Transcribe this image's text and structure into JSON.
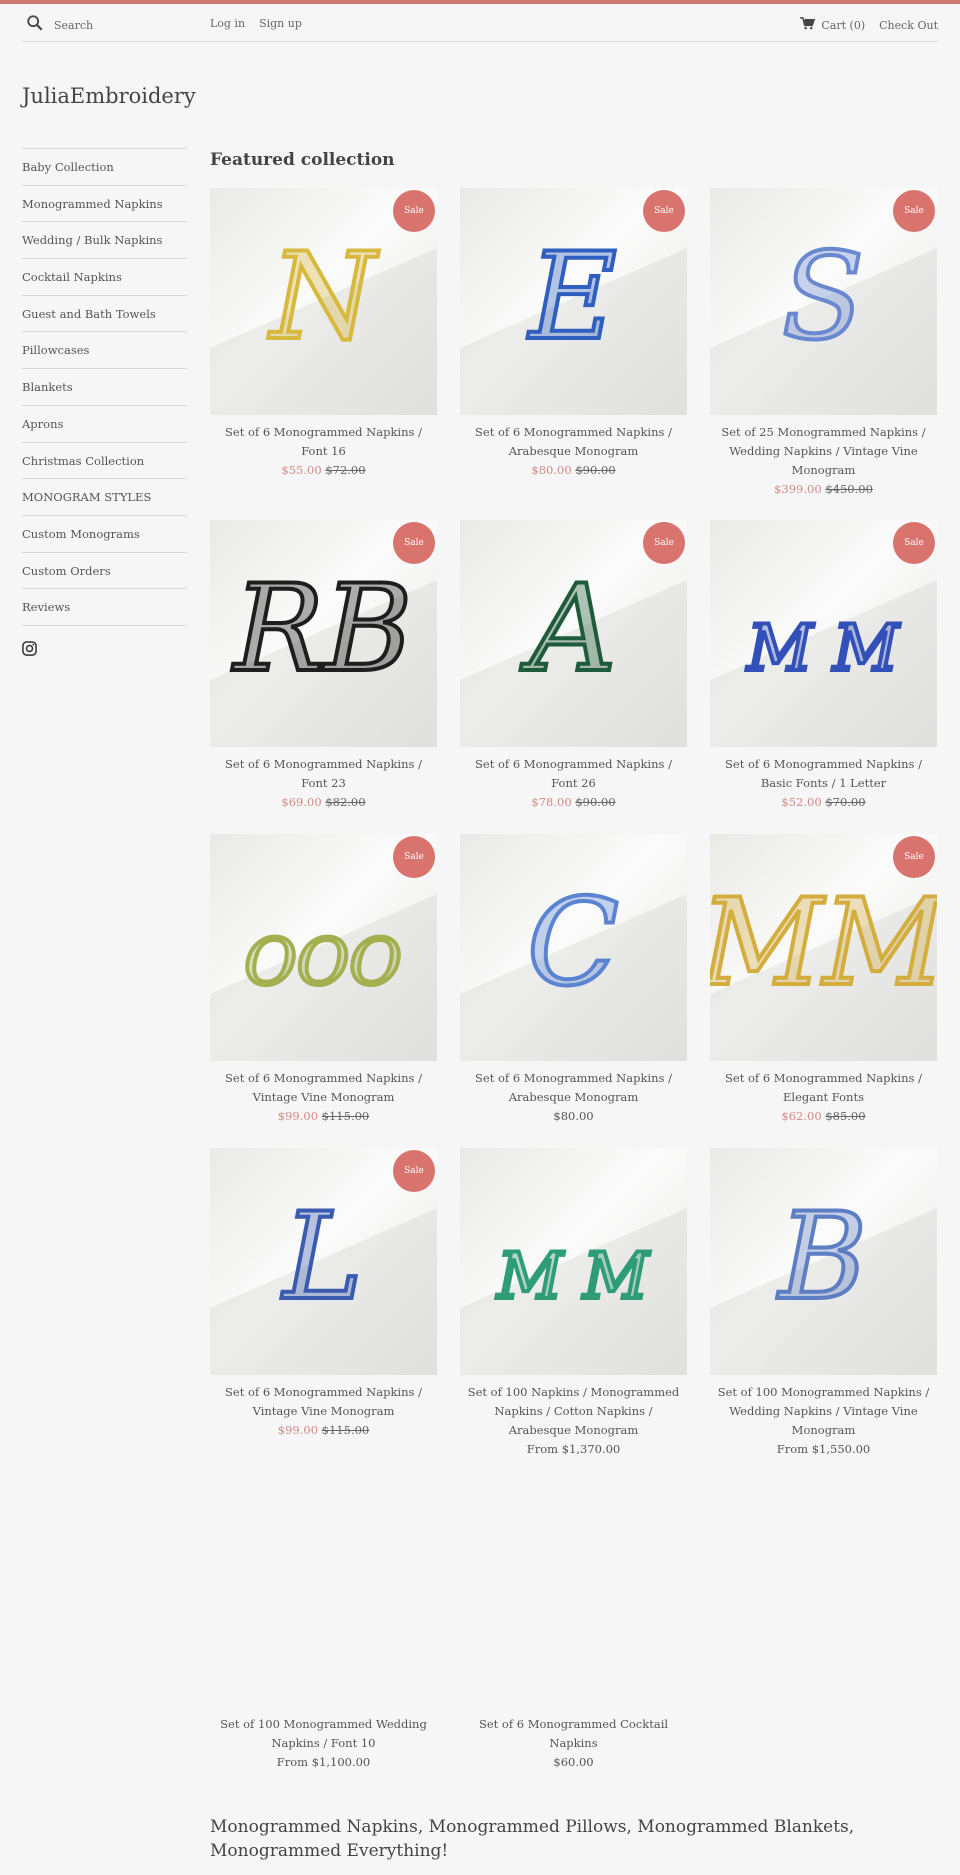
{
  "header": {
    "search_placeholder": "Search",
    "login": "Log in",
    "signup": "Sign up",
    "cart": "Cart (0)",
    "checkout": "Check Out"
  },
  "brand": {
    "name": "JuliaEmbroidery",
    "accent": "#d17a74"
  },
  "sidebar": {
    "items": [
      "Baby Collection",
      "Monogrammed Napkins",
      "Wedding / Bulk Napkins",
      "Cocktail Napkins",
      "Guest and Bath Towels",
      "Pillowcases",
      "Blankets",
      "Aprons",
      "Christmas Collection",
      "MONOGRAM STYLES",
      "Custom Monograms",
      "Custom Orders",
      "Reviews"
    ]
  },
  "featured": {
    "title": "Featured collection",
    "sale_label": "Sale",
    "products": [
      {
        "name": "Set of 6 Monogrammed Napkins / Font 16",
        "sale": "$55.00",
        "orig": "$72.00",
        "letter": "N",
        "color": "#d8b93f"
      },
      {
        "name": "Set of 6 Monogrammed Napkins / Arabesque Monogram",
        "sale": "$80.00",
        "orig": "$90.00",
        "letter": "E",
        "color": "#2f5fbf"
      },
      {
        "name": "Set of 25 Monogrammed Napkins / Wedding Napkins / Vintage Vine Monogram",
        "sale": "$399.00",
        "orig": "$450.00",
        "letter": "S",
        "color": "#6a88d0"
      },
      {
        "name": "Set of 6 Monogrammed Napkins / Font 23",
        "sale": "$69.00",
        "orig": "$82.00",
        "letter": "RB",
        "color": "#1e1e1e"
      },
      {
        "name": "Set of 6 Monogrammed Napkins / Font 26",
        "sale": "$78.00",
        "orig": "$90.00",
        "letter": "A",
        "color": "#1f5b3a"
      },
      {
        "name": "Set of 6 Monogrammed Napkins / Basic Fonts / 1 Letter",
        "sale": "$52.00",
        "orig": "$70.00",
        "letter": "M M",
        "color": "#3350b8"
      },
      {
        "name": "Set of 6 Monogrammed Napkins / Vintage Vine Monogram",
        "sale": "$99.00",
        "orig": "$115.00",
        "letter": "OOO",
        "color": "#a3b04f"
      },
      {
        "name": "Set of 6 Monogrammed Napkins / Arabesque Monogram",
        "regular": "$80.00",
        "letter": "C",
        "color": "#5a84d2"
      },
      {
        "name": "Set of 6 Monogrammed Napkins / Elegant Fonts",
        "sale": "$62.00",
        "orig": "$85.00",
        "letter": "MM",
        "color": "#d4ad3f"
      },
      {
        "name": "Set of 6 Monogrammed Napkins / Vintage Vine Monogram",
        "sale": "$99.00",
        "orig": "$115.00",
        "letter": "L",
        "color": "#3a5bb0"
      },
      {
        "name": "Set of 100 Napkins / Monogrammed Napkins / Cotton Napkins / Arabesque Monogram",
        "regular": "From $1,370.00",
        "letter": "M M",
        "color": "#2f9c78"
      },
      {
        "name": "Set of 100 Monogrammed Napkins / Wedding Napkins / Vintage Vine Monogram",
        "regular": "From $1,550.00",
        "letter": "B",
        "color": "#5e7ec4"
      },
      {
        "name": "Set of 100 Monogrammed Wedding Napkins / Font 10",
        "regular": "From $1,100.00",
        "blank": true
      },
      {
        "name": "Set of 6 Monogrammed Cocktail Napkins",
        "regular": "$60.00",
        "blank": true
      }
    ]
  },
  "footer_heading": "Monogrammed Napkins, Monogrammed Pillows, Monogrammed Blankets, Monogrammed Everything!"
}
